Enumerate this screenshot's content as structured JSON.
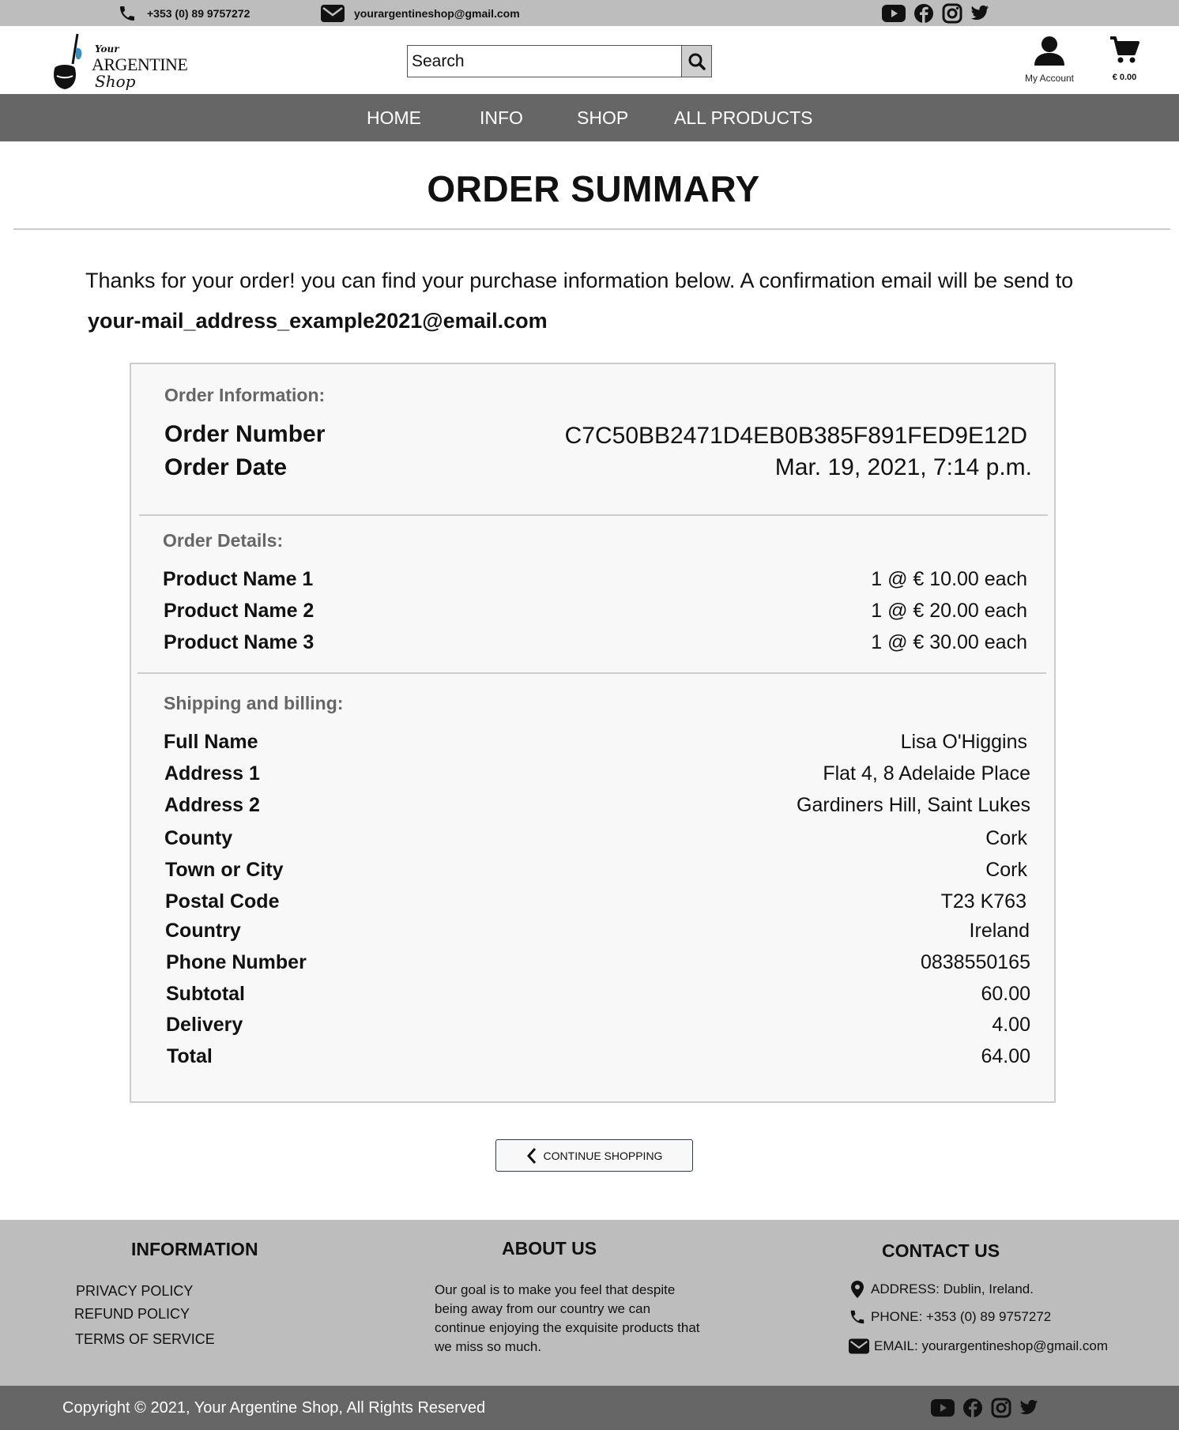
{
  "topbar": {
    "phone": "+353 (0) 89 9757272",
    "email": "yourargentineshop@gmail.com",
    "social_icons": [
      "youtube-icon",
      "facebook-icon",
      "instagram-icon",
      "twitter-icon"
    ]
  },
  "header": {
    "logo": {
      "your": "Your",
      "argentine": "ARGENTINE",
      "shop": "Shop"
    },
    "search_placeholder": "Search",
    "account_label": "My Account",
    "cart_total": "€ 0.00"
  },
  "nav": {
    "items": [
      "HOME",
      "INFO",
      "SHOP",
      "ALL PRODUCTS"
    ]
  },
  "main": {
    "title": "ORDER SUMMARY",
    "thanks": "Thanks for your order! you can find your purchase information below. A confirmation email will be send to",
    "email": "your-mail_address_example2021@email.com"
  },
  "order_info": {
    "heading": "Order Information:",
    "rows": [
      {
        "label": "Order Number",
        "value": "C7C50BB2471D4EB0B385F891FED9E12D"
      },
      {
        "label": "Order Date",
        "value": "Mar. 19, 2021, 7:14 p.m."
      }
    ]
  },
  "order_details": {
    "heading": "Order Details:",
    "rows": [
      {
        "label": "Product Name 1",
        "value": "1 @ € 10.00 each"
      },
      {
        "label": "Product Name 2",
        "value": "1 @ € 20.00 each"
      },
      {
        "label": "Product Name 3",
        "value": "1 @ € 30.00 each"
      }
    ]
  },
  "shipping": {
    "heading": "Shipping and billing:",
    "rows": [
      {
        "label": "Full Name",
        "value": "Lisa O'Higgins"
      },
      {
        "label": "Address 1",
        "value": "Flat 4, 8 Adelaide Place"
      },
      {
        "label": "Address 2",
        "value": "Gardiners Hill, Saint Lukes"
      },
      {
        "label": "County",
        "value": "Cork"
      },
      {
        "label": "Town or City",
        "value": "Cork"
      },
      {
        "label": "Postal Code",
        "value": "T23 K763"
      },
      {
        "label": "Country",
        "value": "Ireland"
      },
      {
        "label": "Phone Number",
        "value": "0838550165"
      },
      {
        "label": "Subtotal",
        "value": "60.00"
      },
      {
        "label": "Delivery",
        "value": "4.00"
      },
      {
        "label": "Total",
        "value": "64.00"
      }
    ]
  },
  "continue_label": "CONTINUE SHOPPING",
  "footer": {
    "information": {
      "heading": "INFORMATION",
      "links": [
        "PRIVACY POLICY",
        "REFUND POLICY",
        "TERMS OF SERVICE"
      ]
    },
    "about": {
      "heading": "ABOUT US",
      "text": "Our goal is to make you feel that despite being away from our country we can continue enjoying the exquisite products that we miss so much."
    },
    "contact": {
      "heading": "CONTACT US",
      "address": "ADDRESS: Dublin, Ireland.",
      "phone": "PHONE: +353 (0) 89 9757272",
      "email": "EMAIL: yourargentineshop@gmail.com"
    },
    "copyright": "Copyright © 2021, Your Argentine Shop, All Rights Reserved"
  }
}
